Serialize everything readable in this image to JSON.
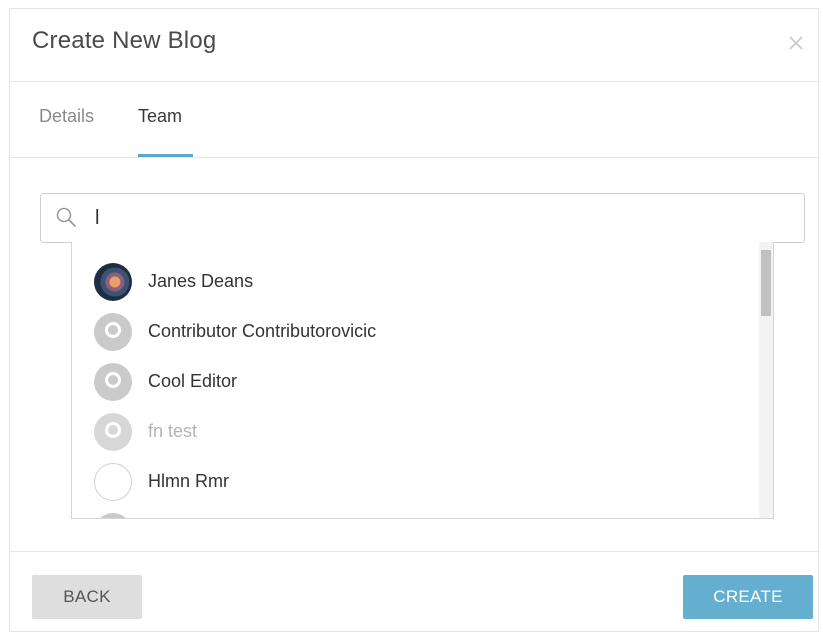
{
  "dialog": {
    "title": "Create New Blog",
    "close_icon": "close-icon"
  },
  "tabs": [
    {
      "label": "Details",
      "active": false
    },
    {
      "label": "Team",
      "active": true
    }
  ],
  "search": {
    "value": "l",
    "placeholder": "",
    "icon": "search-icon"
  },
  "results": [
    {
      "name": "Janes Deans",
      "avatar": "photo",
      "muted": false
    },
    {
      "name": "Contributor Contributorovicic",
      "avatar": "default",
      "muted": false
    },
    {
      "name": "Cool Editor",
      "avatar": "default",
      "muted": false
    },
    {
      "name": "fn test",
      "avatar": "default",
      "muted": true
    },
    {
      "name": "Hlmn Rmr",
      "avatar": "empty",
      "muted": false
    },
    {
      "name": "",
      "avatar": "default",
      "muted": false
    }
  ],
  "footer": {
    "back_label": "BACK",
    "create_label": "CREATE"
  },
  "colors": {
    "accent": "#5aa8c9",
    "create_button": "#64afd0",
    "back_button": "#dedede"
  }
}
